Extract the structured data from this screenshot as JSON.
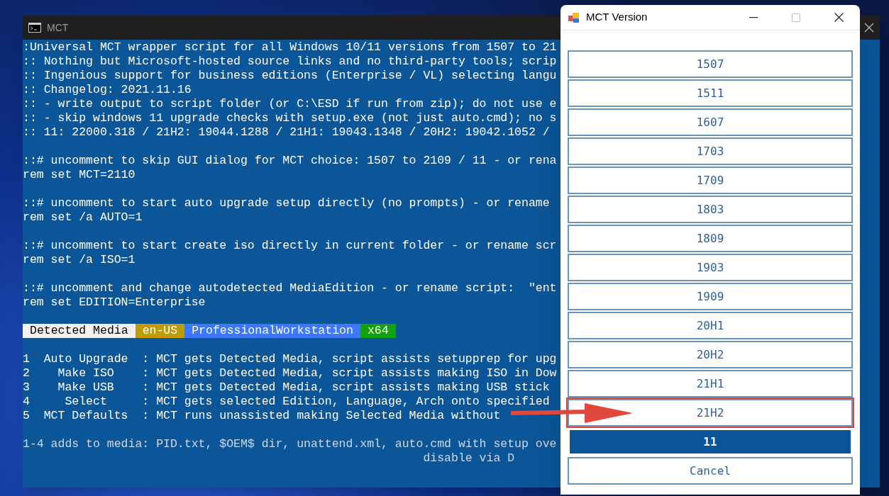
{
  "console": {
    "title": "MCT",
    "header_groups": [
      [
        ":Universal MCT wrapper script for all Windows 10/11 versions from 1507 to 21",
        ":: Nothing but Microsoft-hosted source links and no third-party tools; scrip",
        ":: Ingenious support for business editions (Enterprise / VL) selecting langu",
        ":: Changelog: 2021.11.16",
        ":: - write output to script folder (or C:\\ESD if run from zip); do not use e",
        ":: - skip windows 11 upgrade checks with setup.exe (not just auto.cmd); no s",
        ":: 11: 22000.318 / 21H2: 19044.1288 / 21H1: 19043.1348 / 20H2: 19042.1052 /"
      ],
      [
        "::# uncomment to skip GUI dialog for MCT choice: 1507 to 2109 / 11 - or rena",
        "rem set MCT=2110"
      ],
      [
        "::# uncomment to start auto upgrade setup directly (no prompts) - or rename",
        "rem set /a AUTO=1"
      ],
      [
        "::# uncomment to start create iso directly in current folder - or rename scr",
        "rem set /a ISO=1"
      ],
      [
        "::# uncomment and change autodetected MediaEdition - or rename script:  \"ent",
        "rem set EDITION=Enterprise"
      ]
    ],
    "media_tags": [
      {
        "label": "Detected Media",
        "color": "#f2f2f2"
      },
      {
        "label": "en-US",
        "color": "#c19c00"
      },
      {
        "label": "ProfessionalWorkstation",
        "color": "#3b78ff"
      },
      {
        "label": "x64",
        "color": "#13a10e"
      }
    ],
    "menu_lines": [
      "1  Auto Upgrade  : MCT gets Detected Media, script assists setupprep for upg",
      "2    Make ISO    : MCT gets Detected Media, script assists making ISO in Dow",
      "3    Make USB    : MCT gets Detected Media, script assists making USB stick",
      "4     Select     : MCT gets selected Edition, Language, Arch onto specified",
      "5  MCT Defaults  : MCT runs unassisted making Selected Media without"
    ],
    "footer_lines": [
      "1-4 adds to media: PID.txt, $OEM$ dir, unattend.xml, auto.cmd with setup ove",
      "                                                         disable via D"
    ]
  },
  "dialog": {
    "title": "MCT Version",
    "versions": [
      {
        "label": "1507",
        "selected": false,
        "highlighted": false
      },
      {
        "label": "1511",
        "selected": false,
        "highlighted": false
      },
      {
        "label": "1607",
        "selected": false,
        "highlighted": false
      },
      {
        "label": "1703",
        "selected": false,
        "highlighted": false
      },
      {
        "label": "1709",
        "selected": false,
        "highlighted": false
      },
      {
        "label": "1803",
        "selected": false,
        "highlighted": false
      },
      {
        "label": "1809",
        "selected": false,
        "highlighted": false
      },
      {
        "label": "1903",
        "selected": false,
        "highlighted": false
      },
      {
        "label": "1909",
        "selected": false,
        "highlighted": false
      },
      {
        "label": "20H1",
        "selected": false,
        "highlighted": false
      },
      {
        "label": "20H2",
        "selected": false,
        "highlighted": false
      },
      {
        "label": "21H1",
        "selected": false,
        "highlighted": false
      },
      {
        "label": "21H2",
        "selected": false,
        "highlighted": true
      },
      {
        "label": "11",
        "selected": true,
        "highlighted": false
      }
    ],
    "cancel": "Cancel"
  }
}
